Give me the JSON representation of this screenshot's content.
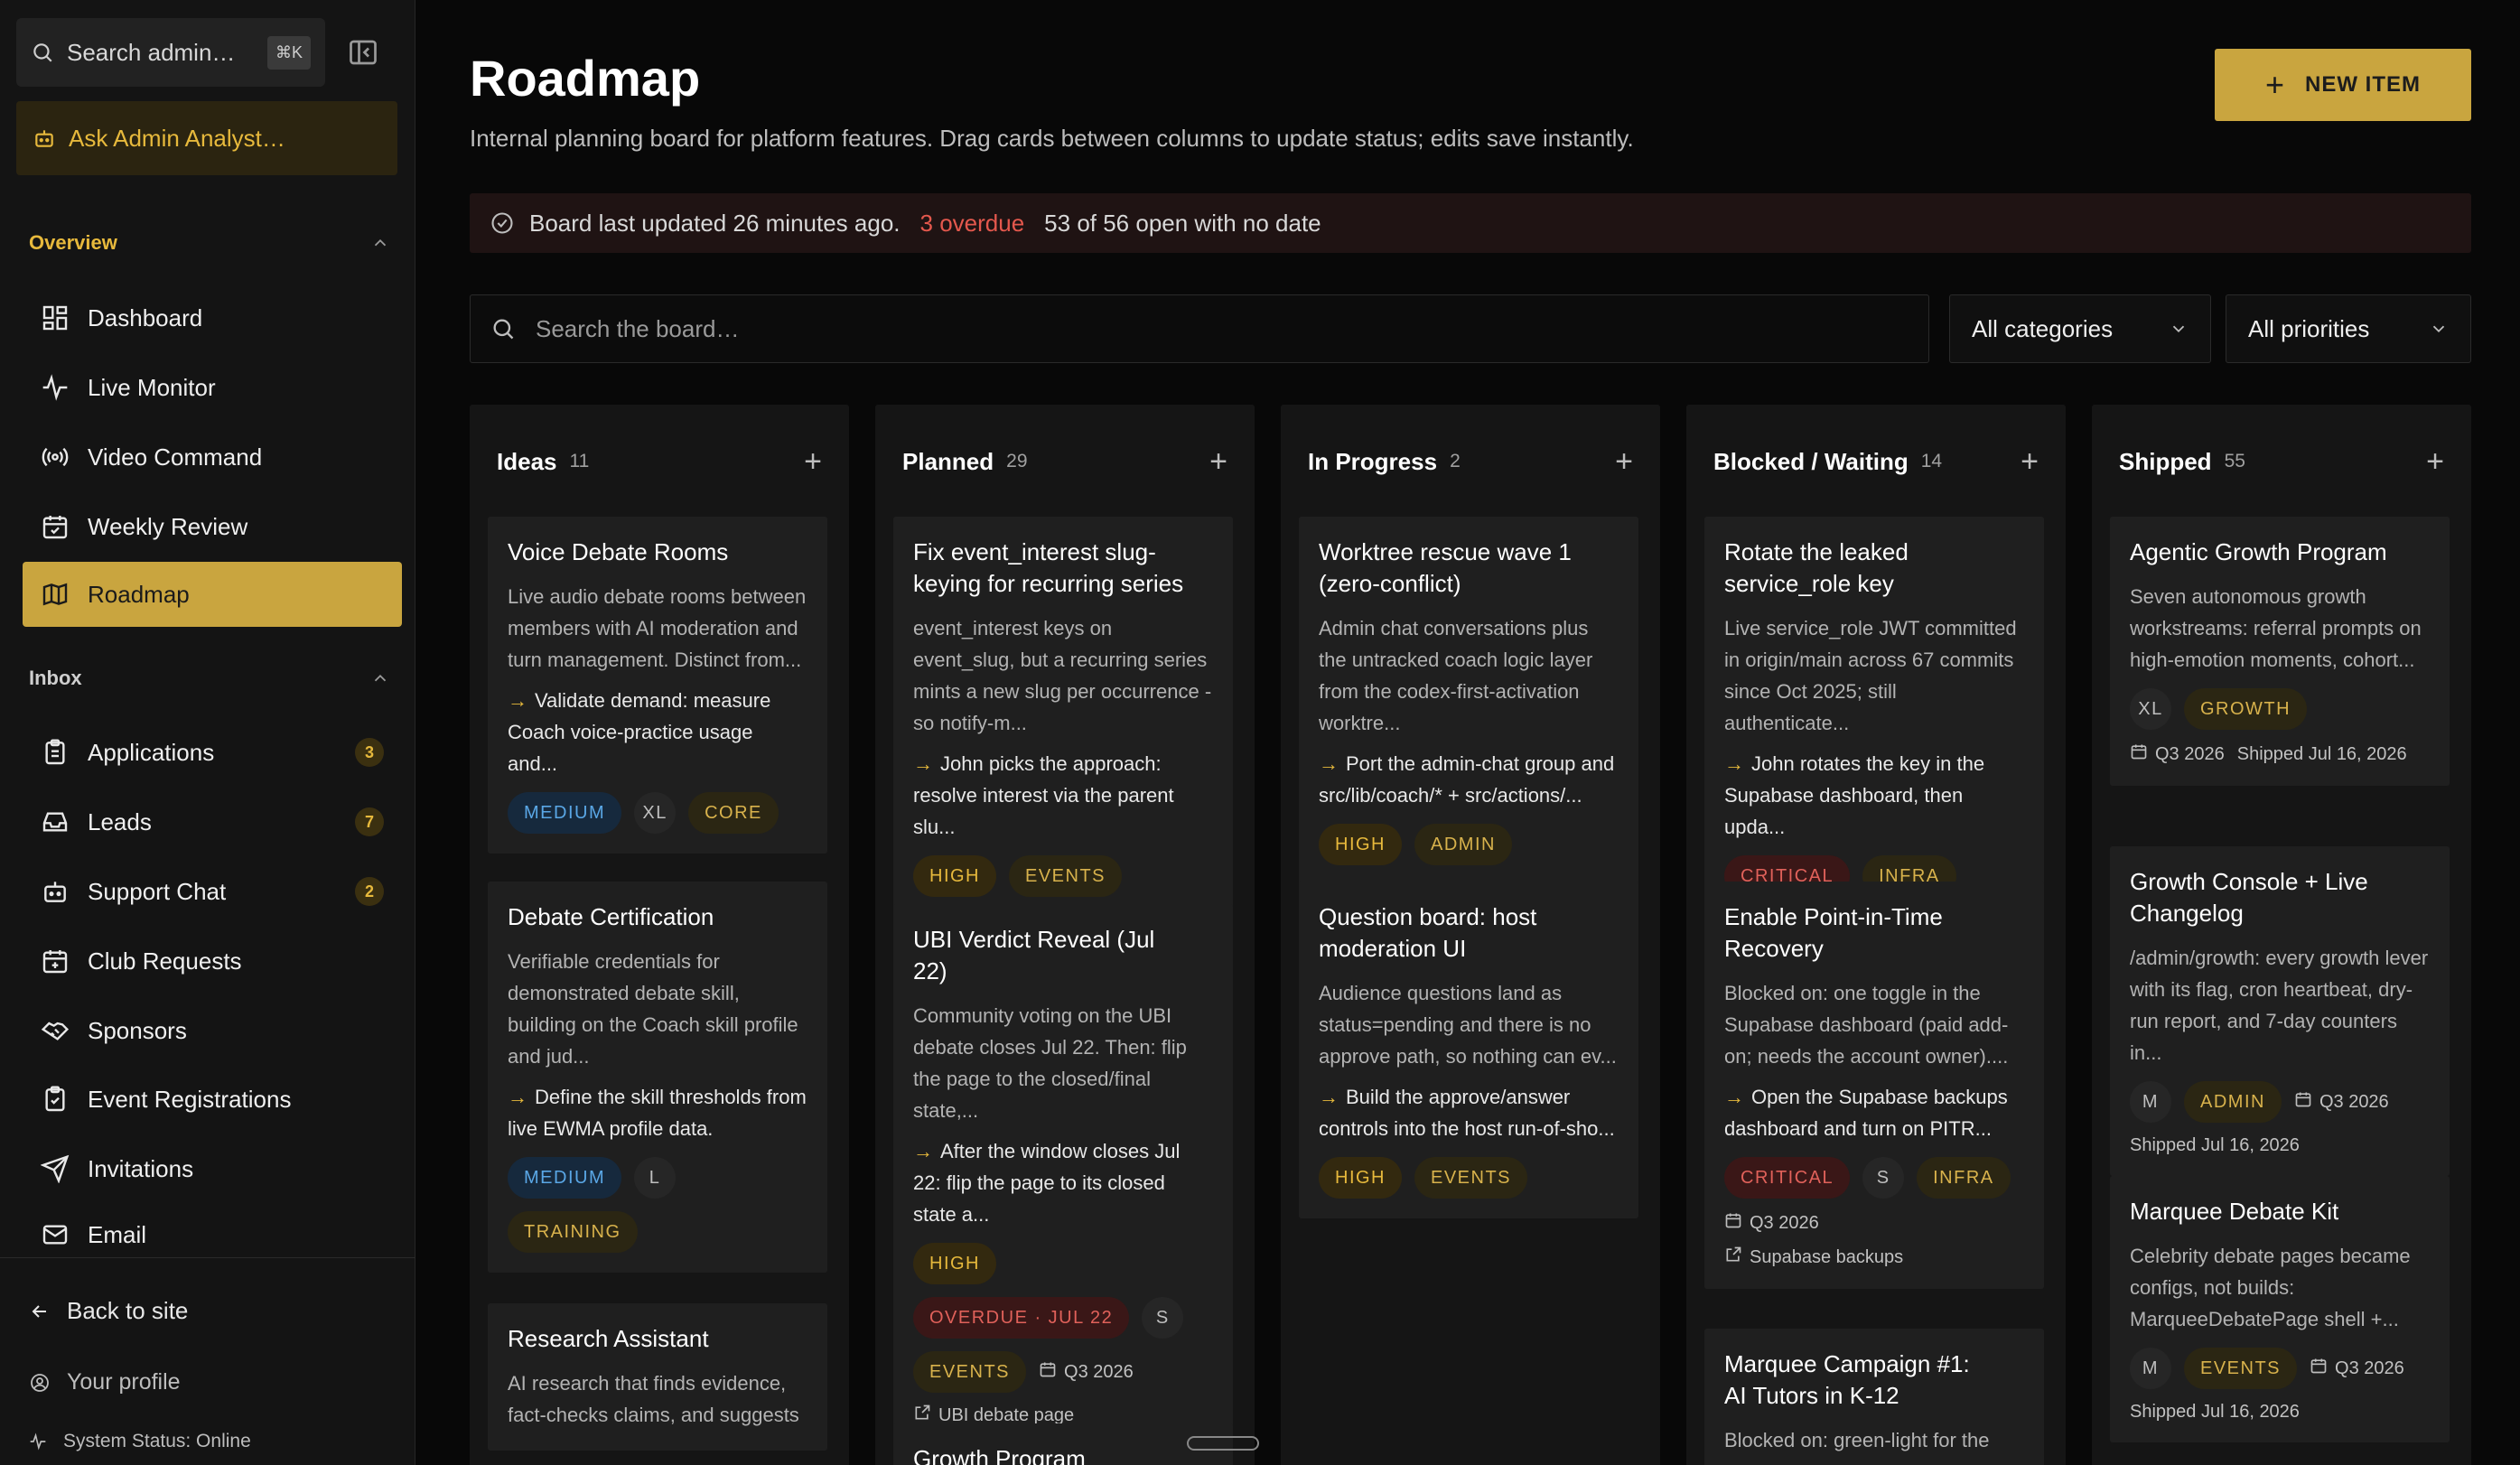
{
  "sidebar": {
    "search_placeholder": "Search admin…",
    "search_shortcut": "⌘K",
    "ask_label": "Ask Admin Analyst…",
    "overview_label": "Overview",
    "overview_items": [
      {
        "label": "Dashboard",
        "icon": "dashboard-icon"
      },
      {
        "label": "Live Monitor",
        "icon": "pulse-icon"
      },
      {
        "label": "Video Command",
        "icon": "broadcast-icon"
      },
      {
        "label": "Weekly Review",
        "icon": "calendar-check-icon"
      },
      {
        "label": "Roadmap",
        "icon": "map-icon",
        "active": true
      }
    ],
    "inbox_label": "Inbox",
    "inbox_items": [
      {
        "label": "Applications",
        "icon": "clipboard-icon",
        "badge": "3"
      },
      {
        "label": "Leads",
        "icon": "inbox-icon",
        "badge": "7"
      },
      {
        "label": "Support Chat",
        "icon": "bot-icon",
        "badge": "2"
      },
      {
        "label": "Club Requests",
        "icon": "calendar-plus-icon"
      },
      {
        "label": "Sponsors",
        "icon": "handshake-icon"
      },
      {
        "label": "Event Registrations",
        "icon": "clipboard-list-icon"
      },
      {
        "label": "Invitations",
        "icon": "send-icon"
      },
      {
        "label": "Email",
        "icon": "mail-icon"
      }
    ],
    "back_label": "Back to site",
    "profile_label": "Your profile",
    "system_status": "System Status: Online"
  },
  "header": {
    "title": "Roadmap",
    "subtitle": "Internal planning board for platform features. Drag cards between columns to update status; edits save instantly.",
    "new_button": "NEW ITEM"
  },
  "status": {
    "updated": "Board last updated 26 minutes ago.",
    "overdue": "3 overdue",
    "nodate": "53 of 56 open with no date"
  },
  "filters": {
    "search_placeholder": "Search the board…",
    "categories": "All categories",
    "priorities": "All priorities"
  },
  "columns": [
    {
      "name": "Ideas",
      "count": "11",
      "cards": [
        {
          "title": "Voice Debate Rooms",
          "desc": "Live audio debate rooms between members with AI moderation and turn management. Distinct from...",
          "next": "Validate demand: measure Coach voice-practice usage and...",
          "tags": [
            {
              "t": "MEDIUM",
              "k": "med"
            },
            {
              "t": "XL",
              "k": "size"
            },
            {
              "t": "CORE",
              "k": "cat"
            }
          ]
        },
        {
          "title": "Debate Certification",
          "desc": "Verifiable credentials for demonstrated debate skill, building on the Coach skill profile and jud...",
          "next": "Define the skill thresholds from live EWMA profile data.",
          "tags": [
            {
              "t": "MEDIUM",
              "k": "med"
            },
            {
              "t": "L",
              "k": "size"
            },
            {
              "t": "TRAINING",
              "k": "cat"
            }
          ]
        },
        {
          "title": "Research Assistant",
          "desc": "AI research that finds evidence, fact-checks claims, and suggests"
        }
      ]
    },
    {
      "name": "Planned",
      "count": "29",
      "cards": [
        {
          "title": "Fix event_interest slug-keying for recurring series",
          "desc": "event_interest keys on event_slug, but a recurring series mints a new slug per occurrence - so notify-m...",
          "next": "John picks the approach: resolve interest via the parent slu...",
          "tags": [
            {
              "t": "HIGH",
              "k": "high"
            },
            {
              "t": "EVENTS",
              "k": "cat"
            }
          ]
        },
        {
          "title": "UBI Verdict Reveal (Jul 22)",
          "desc": "Community voting on the UBI debate closes Jul 22. Then: flip the page to the closed/final state,...",
          "next": "After the window closes Jul 22: flip the page to its closed state a...",
          "tags": [
            {
              "t": "HIGH",
              "k": "high"
            }
          ],
          "tags2": [
            {
              "t": "OVERDUE · JUL 22",
              "k": "over"
            },
            {
              "t": "S",
              "k": "size"
            }
          ],
          "tags3": [
            {
              "t": "EVENTS",
              "k": "cat"
            }
          ],
          "quarter": "Q3 2026",
          "link": "UBI debate page"
        },
        {
          "title": "Growth Program"
        }
      ]
    },
    {
      "name": "In Progress",
      "count": "2",
      "cards": [
        {
          "title": "Worktree rescue wave 1 (zero-conflict)",
          "desc": "Admin chat conversations plus the untracked coach logic layer from the codex-first-activation worktre...",
          "next": "Port the admin-chat group and src/lib/coach/* + src/actions/...",
          "tags": [
            {
              "t": "HIGH",
              "k": "high"
            },
            {
              "t": "ADMIN",
              "k": "cat"
            }
          ]
        },
        {
          "title": "Question board: host moderation UI",
          "desc": "Audience questions land as status=pending and there is no approve path, so nothing can ev...",
          "next": "Build the approve/answer controls into the host run-of-sho...",
          "tags": [
            {
              "t": "HIGH",
              "k": "high"
            },
            {
              "t": "EVENTS",
              "k": "cat"
            }
          ]
        }
      ]
    },
    {
      "name": "Blocked / Waiting",
      "count": "14",
      "cards": [
        {
          "title": "Rotate the leaked service_role key",
          "desc": "Live service_role JWT committed in origin/main across 67 commits since Oct 2025; still authenticate...",
          "next": "John rotates the key in the Supabase dashboard, then upda...",
          "tags": [
            {
              "t": "CRITICAL",
              "k": "crit"
            },
            {
              "t": "INFRA",
              "k": "cat"
            }
          ]
        },
        {
          "title": "Enable Point-in-Time Recovery",
          "desc": "Blocked on: one toggle in the Supabase dashboard (paid add-on; needs the account owner)....",
          "next": "Open the Supabase backups dashboard and turn on PITR...",
          "tags": [
            {
              "t": "CRITICAL",
              "k": "crit"
            },
            {
              "t": "S",
              "k": "size"
            },
            {
              "t": "INFRA",
              "k": "cat"
            }
          ],
          "quarter": "Q3 2026",
          "link": "Supabase backups"
        },
        {
          "title": "Marquee Campaign #1: AI Tutors in K-12",
          "desc": "Blocked on: green-light for the"
        }
      ]
    },
    {
      "name": "Shipped",
      "count": "55",
      "cards": [
        {
          "title": "Agentic Growth Program",
          "desc": "Seven autonomous growth workstreams: referral prompts on high-emotion moments, cohort...",
          "tags": [
            {
              "t": "XL",
              "k": "size"
            },
            {
              "t": "GROWTH",
              "k": "cat"
            }
          ],
          "quarter": "Q3 2026",
          "shipped": "Shipped Jul 16, 2026"
        },
        {
          "title": "Growth Console + Live Changelog",
          "desc": "/admin/growth: every growth lever with its flag, cron heartbeat, dry-run report, and 7-day counters in...",
          "tags": [
            {
              "t": "M",
              "k": "size"
            },
            {
              "t": "ADMIN",
              "k": "cat"
            }
          ],
          "quarter": "Q3 2026",
          "shipped": "Shipped Jul 16, 2026"
        },
        {
          "title": "Marquee Debate Kit",
          "desc": "Celebrity debate pages became configs, not builds: MarqueeDebatePage shell +...",
          "tags": [
            {
              "t": "M",
              "k": "size"
            },
            {
              "t": "EVENTS",
              "k": "cat"
            }
          ],
          "quarter": "Q3 2026",
          "shipped": "Shipped Jul 16, 2026"
        }
      ]
    }
  ],
  "colors": {
    "accent": "#c9a53f",
    "accent_text": "#e7b93c",
    "overdue": "#e4584d",
    "medium": "#5aa7e6"
  }
}
